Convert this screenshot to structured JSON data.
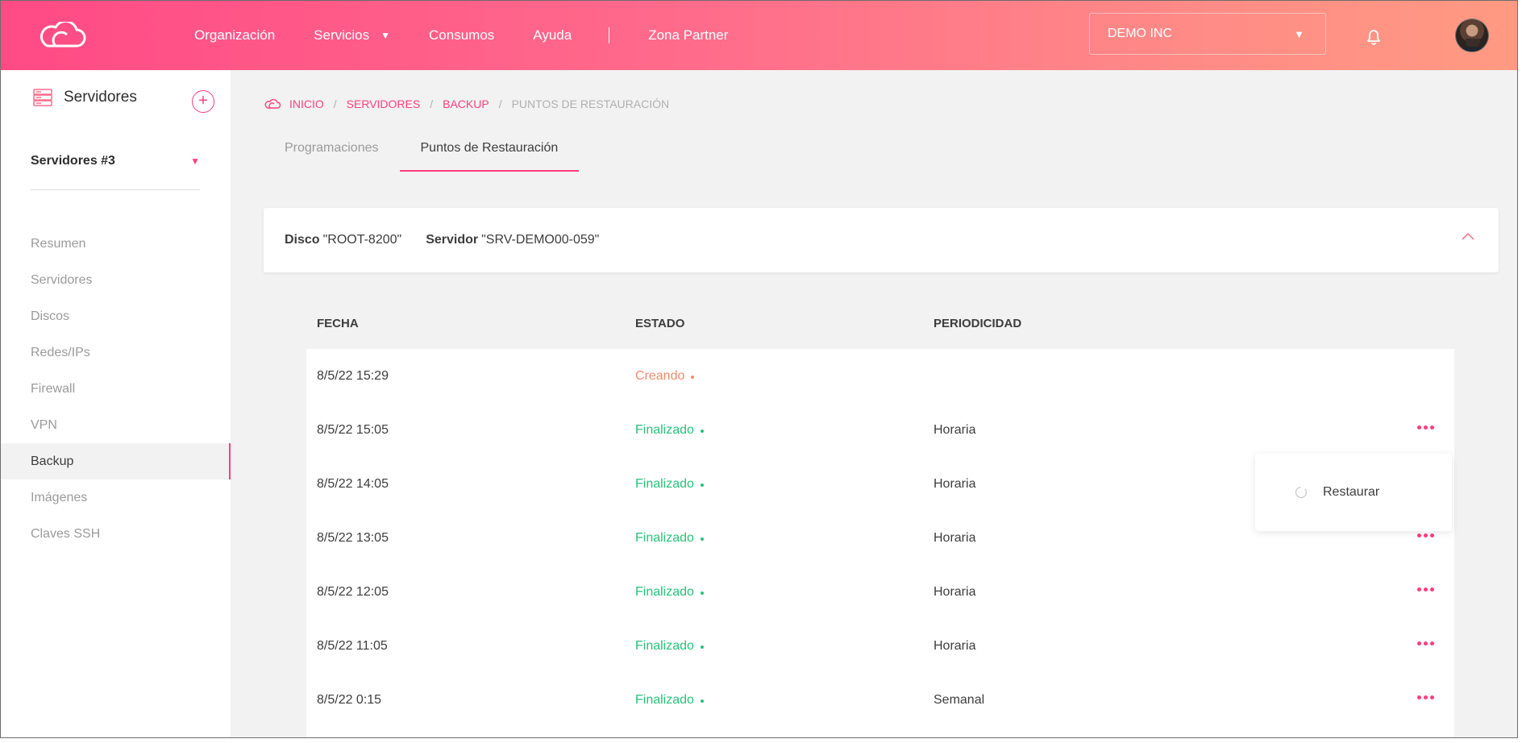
{
  "header": {
    "nav": [
      {
        "label": "Organización"
      },
      {
        "label": "Servicios",
        "has_caret": true
      },
      {
        "label": "Consumos"
      },
      {
        "label": "Ayuda"
      },
      {
        "label": "Zona Partner"
      }
    ],
    "org_select": {
      "value": "DEMO INC"
    }
  },
  "sidebar": {
    "title": "Servidores",
    "group_select": "Servidores #3",
    "items": [
      {
        "label": "Resumen"
      },
      {
        "label": "Servidores"
      },
      {
        "label": "Discos"
      },
      {
        "label": "Redes/IPs"
      },
      {
        "label": "Firewall"
      },
      {
        "label": "VPN"
      },
      {
        "label": "Backup",
        "active": true
      },
      {
        "label": "Imágenes"
      },
      {
        "label": "Claves SSH"
      }
    ]
  },
  "breadcrumb": [
    "INICIO",
    "SERVIDORES",
    "BACKUP",
    "PUNTOS DE RESTAURACIÓN"
  ],
  "tabs": [
    {
      "label": "Programaciones"
    },
    {
      "label": "Puntos de Restauración",
      "active": true
    }
  ],
  "disk_card": {
    "disk_label": "Disco",
    "disk_value": "\"ROOT-8200\"",
    "server_label": "Servidor",
    "server_value": "\"SRV-DEMO00-059\""
  },
  "table": {
    "headers": [
      "FECHA",
      "ESTADO",
      "PERIODICIDAD"
    ],
    "rows": [
      {
        "fecha": "8/5/22 15:29",
        "estado": "Creando",
        "periodicidad": "",
        "status_color": "#f5896b",
        "actions": false
      },
      {
        "fecha": "8/5/22 15:05",
        "estado": "Finalizado",
        "periodicidad": "Horaria",
        "status_color": "#27c27a",
        "actions": true
      },
      {
        "fecha": "8/5/22 14:05",
        "estado": "Finalizado",
        "periodicidad": "Horaria",
        "status_color": "#27c27a",
        "actions": false
      },
      {
        "fecha": "8/5/22 13:05",
        "estado": "Finalizado",
        "periodicidad": "Horaria",
        "status_color": "#27c27a",
        "actions": true
      },
      {
        "fecha": "8/5/22 12:05",
        "estado": "Finalizado",
        "periodicidad": "Horaria",
        "status_color": "#27c27a",
        "actions": true
      },
      {
        "fecha": "8/5/22 11:05",
        "estado": "Finalizado",
        "periodicidad": "Horaria",
        "status_color": "#27c27a",
        "actions": true
      },
      {
        "fecha": "8/5/22 0:15",
        "estado": "Finalizado",
        "periodicidad": "Semanal",
        "status_color": "#27c27a",
        "actions": true
      }
    ]
  },
  "context_menu": {
    "label": "Restaurar",
    "icon": "refresh-icon"
  },
  "colors": {
    "accent": "#ff3d7f",
    "success": "#27c27a",
    "pending": "#f5896b"
  }
}
